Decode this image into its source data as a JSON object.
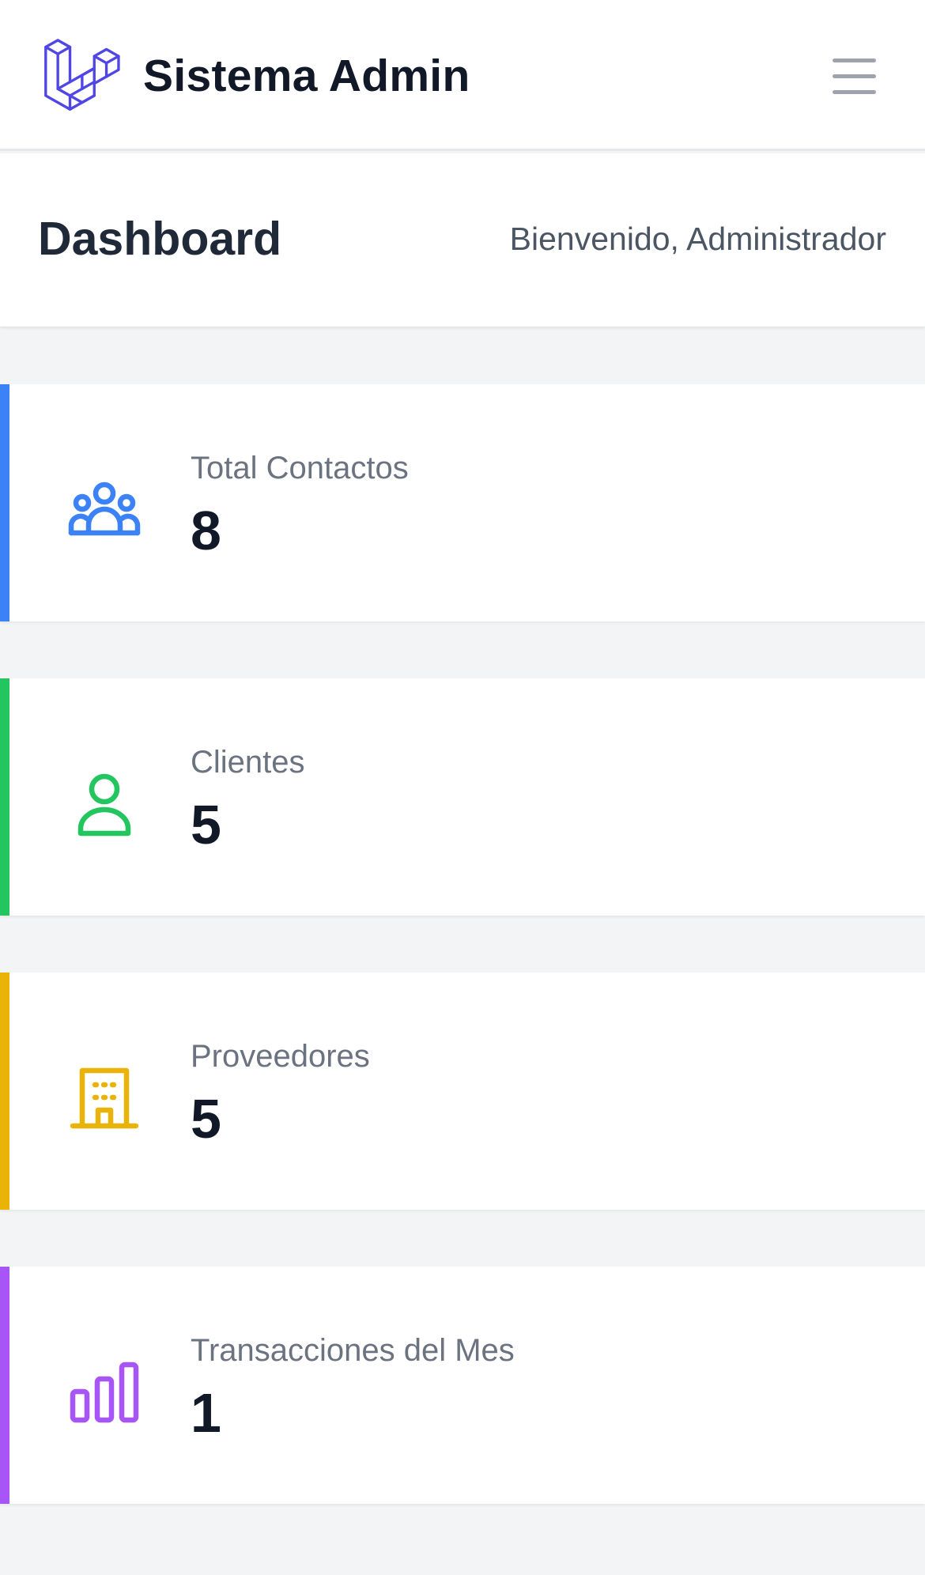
{
  "nav": {
    "app_title": "Sistema Admin",
    "logo_icon": "laravel-logo-icon",
    "logo_color": "#4f46e5",
    "menu_icon": "hamburger-menu-icon"
  },
  "header": {
    "title": "Dashboard",
    "welcome": "Bienvenido, Administrador"
  },
  "stats": [
    {
      "label": "Total Contactos",
      "value": "8",
      "icon": "user-group-icon",
      "color": "#3b82f6"
    },
    {
      "label": "Clientes",
      "value": "5",
      "icon": "user-icon",
      "color": "#22c55e"
    },
    {
      "label": "Proveedores",
      "value": "5",
      "icon": "office-building-icon",
      "color": "#eab308"
    },
    {
      "label": "Transacciones del Mes",
      "value": "1",
      "icon": "chart-bar-icon",
      "color": "#a855f7"
    }
  ]
}
